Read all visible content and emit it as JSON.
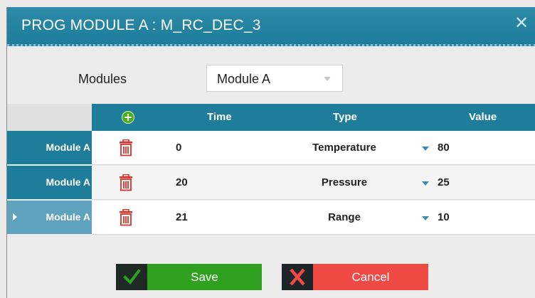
{
  "window": {
    "title": "PROG MODULE A : M_RC_DEC_3"
  },
  "modules": {
    "label": "Modules",
    "selected": "Module A"
  },
  "grid": {
    "columns": {
      "time": "Time",
      "type": "Type",
      "value": "Value"
    },
    "rows": [
      {
        "module": "Module A",
        "time": "0",
        "type": "Temperature",
        "value": "80",
        "selected": false
      },
      {
        "module": "Module A",
        "time": "20",
        "type": "Pressure",
        "value": "25",
        "selected": false
      },
      {
        "module": "Module A",
        "time": "21",
        "type": "Range",
        "value": "10",
        "selected": true
      }
    ]
  },
  "buttons": {
    "save": "Save",
    "cancel": "Cancel"
  },
  "colors": {
    "header": "#1f7d9c",
    "selected_row_header": "#5ea2bd",
    "save": "#2fa01f",
    "cancel": "#f04a45",
    "trash_icon": "#d8322b",
    "add_icon": "#4caf1a"
  },
  "icons": [
    "close-icon",
    "add-icon",
    "trash-icon",
    "check-icon",
    "x-icon",
    "chevron-down-icon"
  ]
}
